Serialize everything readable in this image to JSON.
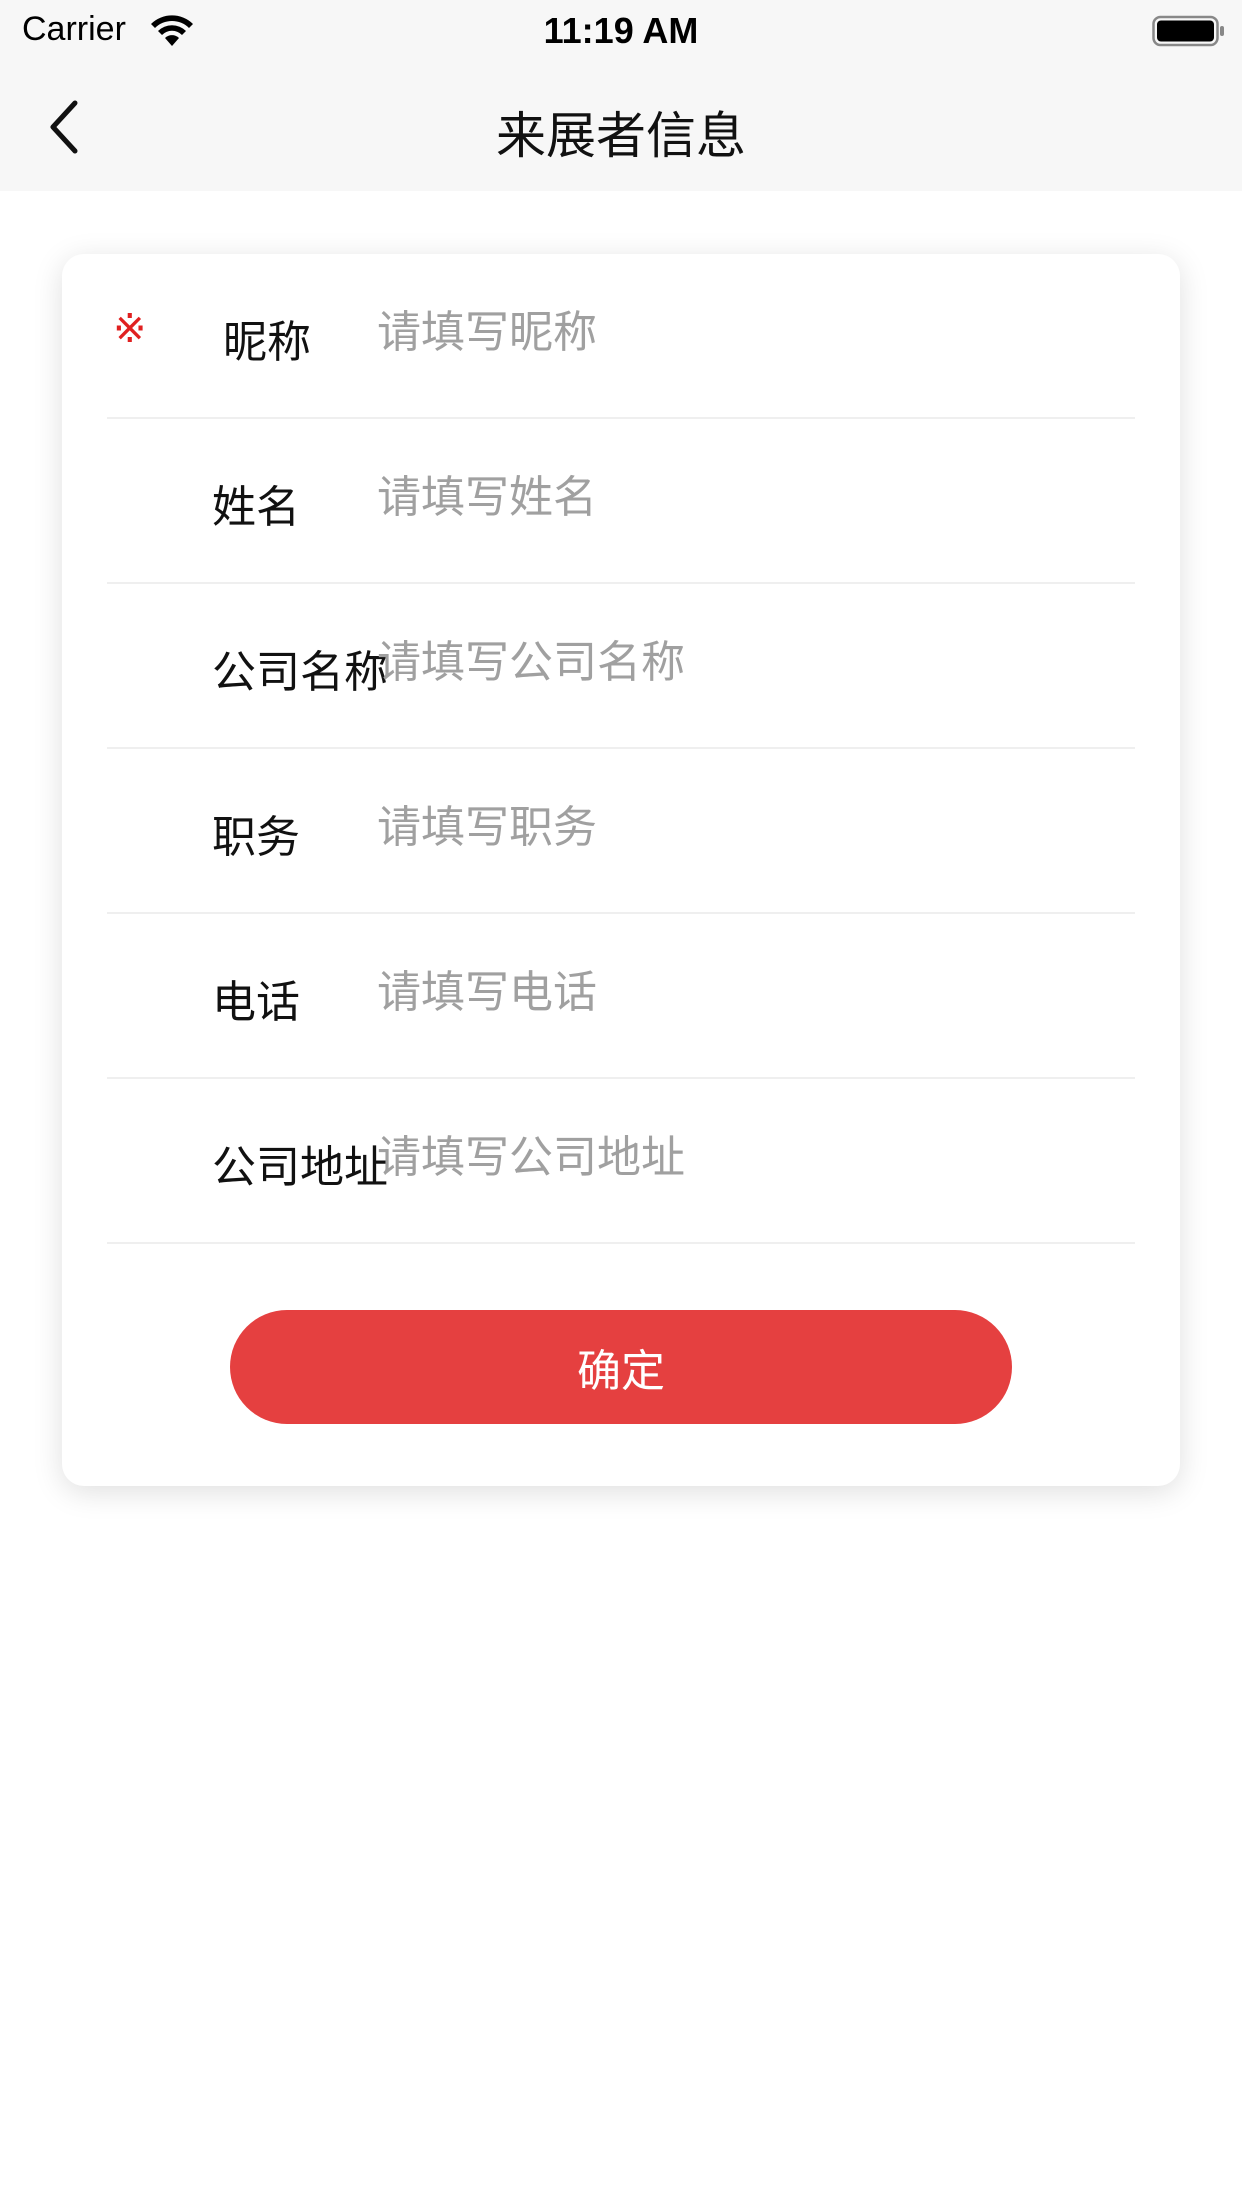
{
  "status_bar": {
    "carrier": "Carrier",
    "time": "11:19 AM",
    "wifi_icon": "wifi-icon",
    "battery_icon": "battery-full-icon"
  },
  "nav": {
    "back_icon": "chevron-left-icon",
    "title": "来展者信息"
  },
  "form": {
    "required_mark": "※",
    "fields": [
      {
        "label": "昵称",
        "placeholder": "请填写昵称",
        "value": "",
        "required": true
      },
      {
        "label": "姓名",
        "placeholder": "请填写姓名",
        "value": "",
        "required": false
      },
      {
        "label": "公司名称",
        "placeholder": "请填写公司名称",
        "value": "",
        "required": false
      },
      {
        "label": "职务",
        "placeholder": "请填写职务",
        "value": "",
        "required": false
      },
      {
        "label": "电话",
        "placeholder": "请填写电话",
        "value": "",
        "required": false
      },
      {
        "label": "公司地址",
        "placeholder": "请填写公司地址",
        "value": "",
        "required": false
      }
    ],
    "submit_label": "确定"
  },
  "colors": {
    "accent": "#e54040",
    "required": "#e02020",
    "nav_background": "#f7f7f7",
    "placeholder": "#a0a0a0"
  }
}
